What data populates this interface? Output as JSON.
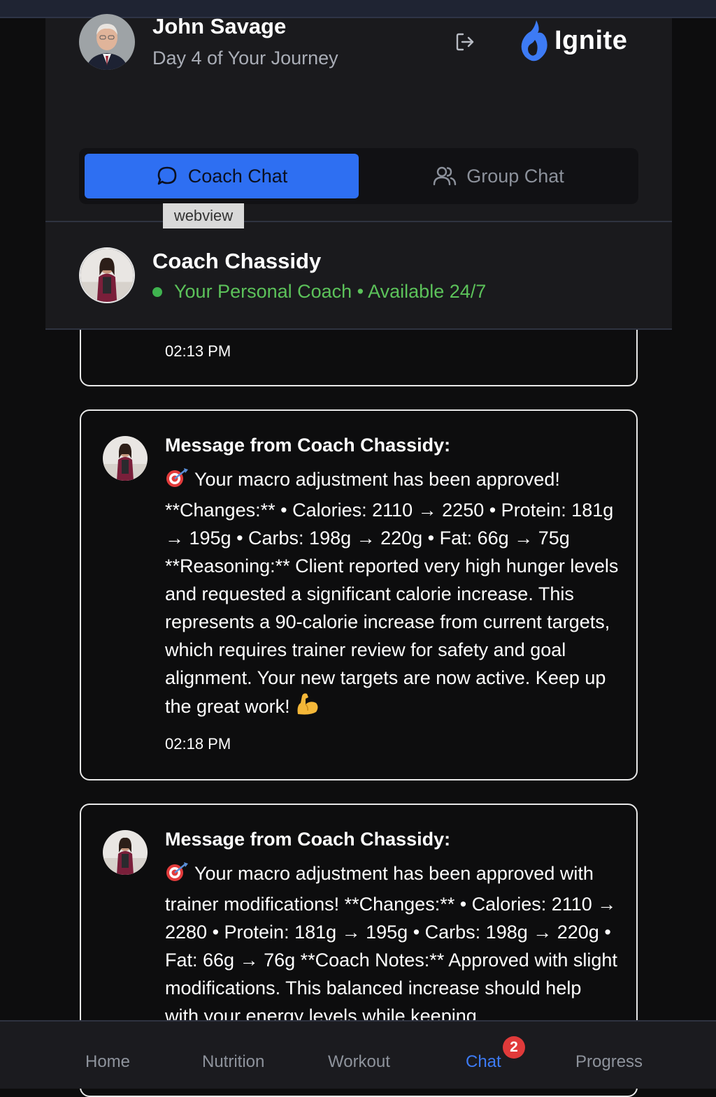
{
  "header": {
    "user_name": "John Savage",
    "journey_text": "Day 4 of Your Journey",
    "logout_icon": "logout-icon",
    "brand_name": "Ignite",
    "brand_color": "#3d7bf5"
  },
  "tabs": [
    {
      "label": "Coach Chat",
      "icon": "chat-bubble-icon",
      "active": true
    },
    {
      "label": "Group Chat",
      "icon": "users-icon",
      "active": false
    }
  ],
  "webview_tag": "webview",
  "coach": {
    "name": "Coach Chassidy",
    "status": "Your Personal Coach • Available 24/7",
    "status_color": "#5cc25a"
  },
  "messages": [
    {
      "time": "02:13 PM"
    },
    {
      "title": "Message from Coach Chassidy:",
      "body_icon": "target-icon",
      "body": "Your macro adjustment has been approved! **Changes:** • Calories: 2110 → 2250 • Protein: 181g → 195g • Carbs: 198g → 220g • Fat: 66g → 75g **Reasoning:** Client reported very high hunger levels and requested a significant calorie increase. This represents a 90-calorie increase from current targets, which requires trainer review for safety and goal alignment. Your new targets are now active. Keep up the great work!",
      "end_icon": "flexed-biceps-icon",
      "time": "02:18 PM"
    },
    {
      "title": "Message from Coach Chassidy:",
      "body_icon": "target-icon",
      "body": "Your macro adjustment has been approved with trainer modifications! **Changes:** • Calories: 2110 → 2280 • Protein: 181g → 195g • Carbs: 198g → 220g • Fat: 66g → 76g **Coach Notes:** Approved with slight modifications. This balanced increase should help with your energy levels while keeping"
    }
  ],
  "bottom_nav": {
    "items": [
      "Home",
      "Nutrition",
      "Workout",
      "Chat",
      "Progress"
    ],
    "active": "Chat",
    "chat_badge": "2",
    "badge_color": "#e03a3a"
  }
}
